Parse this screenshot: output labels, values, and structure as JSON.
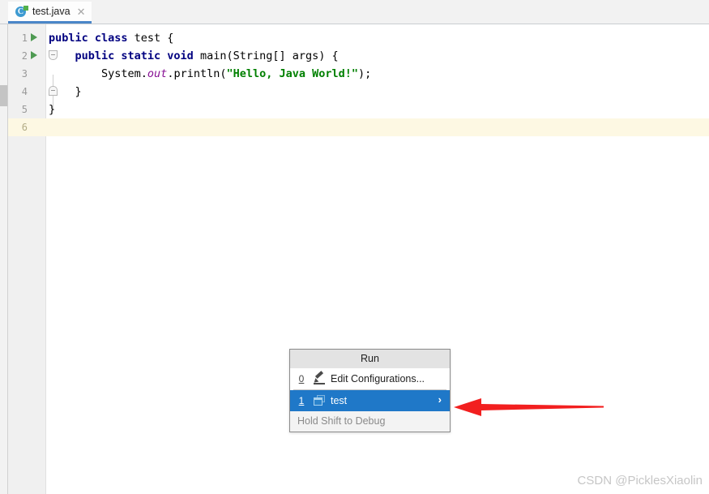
{
  "window": {
    "editor_tab": {
      "label": "test.java",
      "icon": "java-class-icon",
      "close_icon": "close-icon",
      "letter": "C"
    }
  },
  "editor": {
    "lines": [
      {
        "number": "1",
        "has_run_marker": true,
        "fold": null,
        "tokens": [
          {
            "t": "kw",
            "v": "public class "
          },
          {
            "t": "pln",
            "v": "test {"
          }
        ]
      },
      {
        "number": "2",
        "has_run_marker": true,
        "fold": "expanded",
        "tokens": [
          {
            "t": "pln",
            "v": "    "
          },
          {
            "t": "kw",
            "v": "public static void "
          },
          {
            "t": "pln",
            "v": "main(String[] args) {"
          }
        ]
      },
      {
        "number": "3",
        "has_run_marker": false,
        "fold": null,
        "tokens": [
          {
            "t": "pln",
            "v": "        System."
          },
          {
            "t": "fld",
            "v": "out"
          },
          {
            "t": "pln",
            "v": ".println("
          },
          {
            "t": "str",
            "v": "\"Hello, Java World!\""
          },
          {
            "t": "pln",
            "v": ");"
          }
        ]
      },
      {
        "number": "4",
        "has_run_marker": false,
        "fold": "endfold",
        "tokens": [
          {
            "t": "pln",
            "v": "    }"
          }
        ]
      },
      {
        "number": "5",
        "has_run_marker": false,
        "fold": null,
        "tokens": [
          {
            "t": "pln",
            "v": "}"
          }
        ]
      },
      {
        "number": "6",
        "has_run_marker": false,
        "fold": null,
        "caret_line": true,
        "tokens": []
      }
    ]
  },
  "run_popup": {
    "header": "Run",
    "items": [
      {
        "key": "0",
        "icon": "pencil-icon",
        "label": "Edit Configurations...",
        "selected": false,
        "has_chevron": false
      },
      {
        "key": "1",
        "icon": "run-configuration-icon",
        "label": "test",
        "selected": true,
        "has_chevron": true,
        "chevron": "›"
      }
    ],
    "footer": "Hold Shift to Debug"
  },
  "annotation": {
    "arrow_color": "#f21f1f",
    "name": "red-pointer-arrow"
  },
  "watermark": {
    "text": "CSDN @PicklesXiaolin"
  }
}
